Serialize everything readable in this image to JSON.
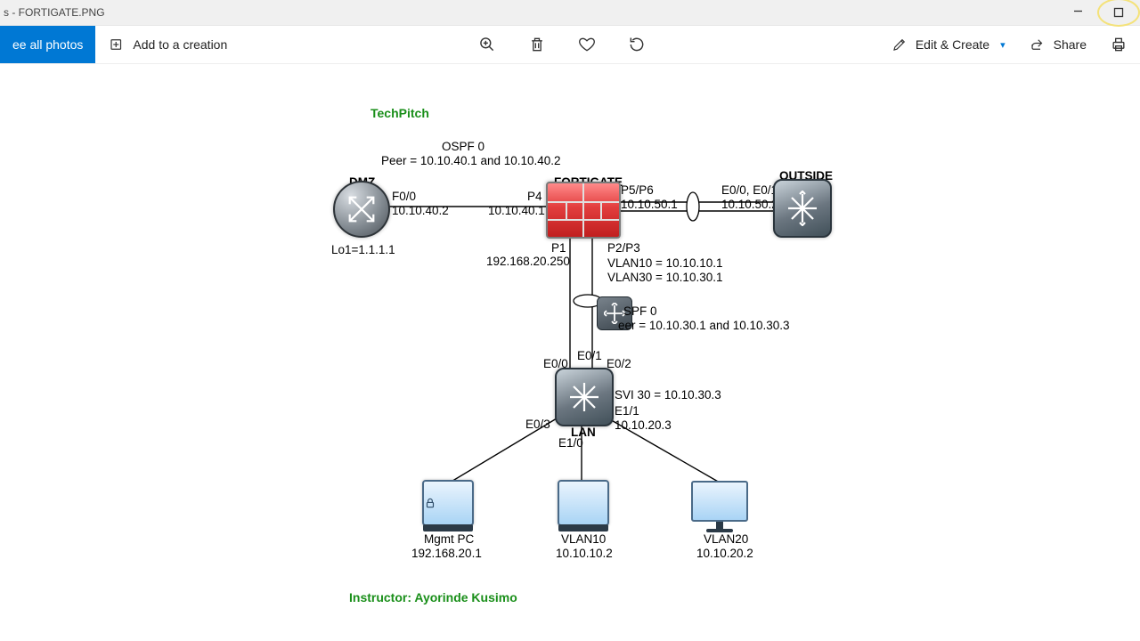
{
  "window": {
    "title": "s - FORTIGATE.PNG"
  },
  "toolbar": {
    "see_all": "ee all photos",
    "add_creation": "Add to a creation",
    "edit_create": "Edit & Create",
    "share": "Share"
  },
  "diagram": {
    "brand": "TechPitch",
    "instructor": "Instructor: Ayorinde Kusimo",
    "ospf_top": {
      "title": "OSPF 0",
      "peer": "Peer = 10.10.40.1 and 10.10.40.2"
    },
    "ospf_mid": {
      "title": "SPF 0",
      "peer": "eer = 10.10.30.1 and 10.10.30.3"
    },
    "dmz": {
      "name": "DMZ",
      "port": "F0/0",
      "ip": "10.10.40.2",
      "loop": "Lo1=1.1.1.1"
    },
    "fortigate": {
      "name": "FORTIGATE",
      "p4": "P4",
      "p4_ip": "10.10.40.1",
      "p5p6": "P5/P6",
      "p5_ip": "10.10.50.1",
      "p1": "P1",
      "p1_ip": "192.168.20.250",
      "p2p3": "P2/P3",
      "vlan10": "VLAN10 = 10.10.10.1",
      "vlan30": "VLAN30 = 10.10.30.1"
    },
    "outside": {
      "name": "OUTSIDE",
      "port": "E0/0, E0/1",
      "ip": "10.10.50.2"
    },
    "lan_switch": {
      "name": "LAN",
      "e00": "E0/0",
      "e01": "E0/1",
      "e02": "E0/2",
      "e03": "E0/3",
      "e10": "E1/0",
      "svi30": "SVI 30 = 10.10.30.3",
      "e11": "E1/1",
      "e11_ip": "10.10.20.3"
    },
    "mgmt": {
      "name": "Mgmt PC",
      "ip": "192.168.20.1"
    },
    "vlan10pc": {
      "name": "VLAN10",
      "ip": "10.10.10.2"
    },
    "vlan20pc": {
      "name": "VLAN20",
      "ip": "10.10.20.2"
    }
  }
}
